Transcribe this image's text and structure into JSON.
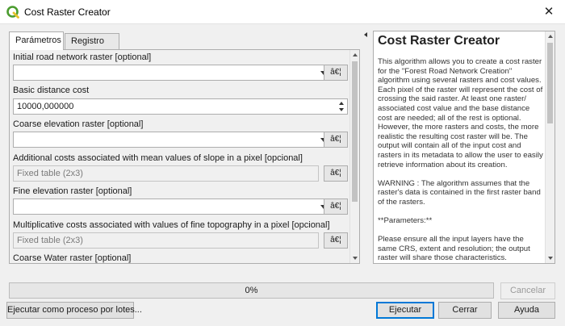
{
  "window": {
    "title": "Cost Raster Creator",
    "close_glyph": "✕"
  },
  "tabs": [
    {
      "label": "Parámetros"
    },
    {
      "label": "Registro"
    }
  ],
  "params": {
    "p1_label": "Initial road network raster [optional]",
    "p2_label": "Basic distance cost",
    "p2_value": "10000,000000",
    "p3_label": "Coarse elevation raster [optional]",
    "p4_label": "Additional costs associated with mean values of slope in a pixel [opcional]",
    "p4_value": "Fixed table (2x3)",
    "p5_label": "Fine elevation raster [optional]",
    "p6_label": "Multiplicative costs associated with values of fine topography in a pixel [opcional]",
    "p6_value": "Fixed table (2x3)",
    "p7_label": "Coarse Water raster [optional]",
    "dots_label": "â€¦"
  },
  "help": {
    "title": "Cost Raster Creator",
    "para1": "This algorithm allows you to create a cost raster for the \"Forest Road Network Creation\" algorithm using several rasters and cost values. Each pixel of the raster will represent the cost of crossing the said raster. At least one raster/ associated cost value and the base distance cost are needed; all of the rest is optional. However, the more rasters and costs, the more realistic the resulting cost raster will be. The output will contain all of the input cost and rasters in its metadata to allow the user to easily retrieve information about its creation.",
    "para2": "WARNING : The algorithm assumes that the raster's data is contained in the first raster band of the rasters.",
    "para3": "**Parameters:**",
    "para4": "Please ensure all the input layers have the same CRS, extent and resolution; the output raster will share those characteristics."
  },
  "progress": {
    "text": "0%",
    "value": 0
  },
  "buttons": {
    "cancel": "Cancelar",
    "batch": "Ejecutar como proceso por lotes...",
    "run": "Ejecutar",
    "close": "Cerrar",
    "help": "Ayuda"
  },
  "colors": {
    "progress_fill": "#06b025",
    "default_button_border": "#0078d7",
    "qgis_green": "#4b9c2f"
  },
  "icons": {
    "app": "qgis-logo-icon",
    "close": "close-icon",
    "dropdown": "chevron-down-icon",
    "spin": "spin-arrows-icon",
    "collapse": "collapse-left-icon"
  }
}
